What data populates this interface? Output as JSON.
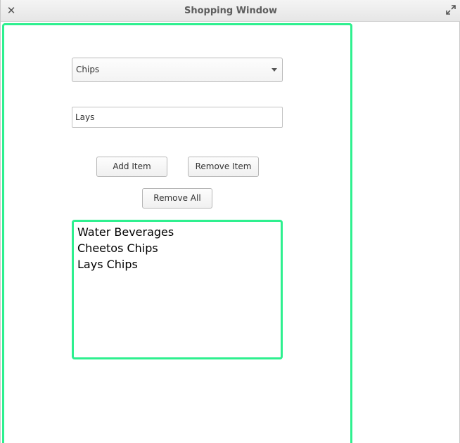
{
  "window": {
    "title": "Shopping Window",
    "close_label": "✕"
  },
  "form": {
    "category_value": "Chips",
    "item_value": "Lays",
    "add_label": "Add Item",
    "remove_label": "Remove Item",
    "remove_all_label": "Remove All"
  },
  "list": {
    "items": [
      "Water Beverages",
      "Cheetos Chips",
      "Lays Chips"
    ]
  },
  "colors": {
    "accent_border": "#2ef08f"
  }
}
